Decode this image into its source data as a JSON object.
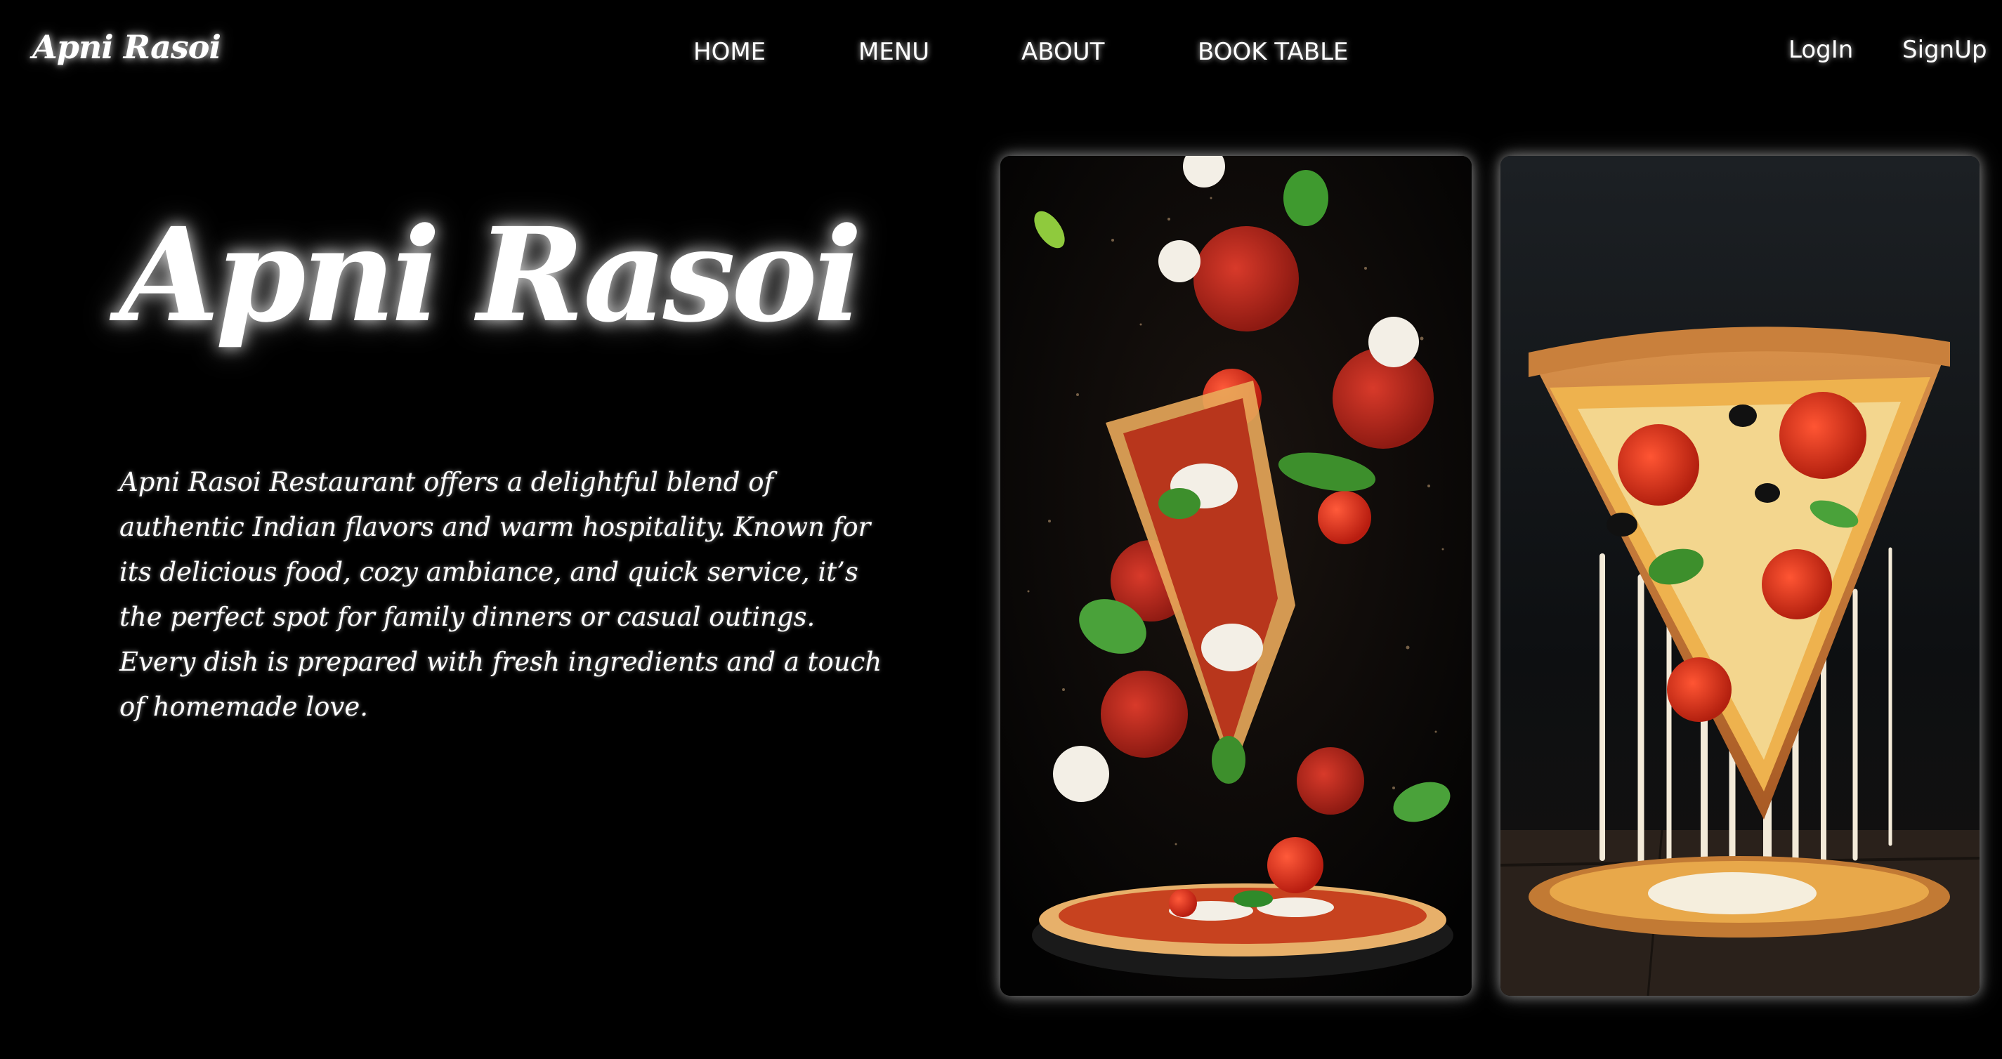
{
  "navbar": {
    "brand": "Apni Rasoi",
    "links": [
      "HOME",
      "MENU",
      "ABOUT",
      "BOOK TABLE"
    ],
    "login": "LogIn",
    "signup": "SignUp"
  },
  "hero": {
    "title": "Apni Rasoi",
    "description": "Apni Rasoi Restaurant offers a delightful blend of authentic Indian flavors and warm hospitality. Known for its delicious food, cozy ambiance, and quick service, it’s the perfect spot for family dinners or casual outings. Every dish is prepared with fresh ingredients and a touch of homemade love."
  },
  "images": [
    {
      "name": "flying pizza toppings photo"
    },
    {
      "name": "cheesy pizza slice photo"
    }
  ],
  "colors": {
    "background": "#000000",
    "text": "#ffffff"
  }
}
